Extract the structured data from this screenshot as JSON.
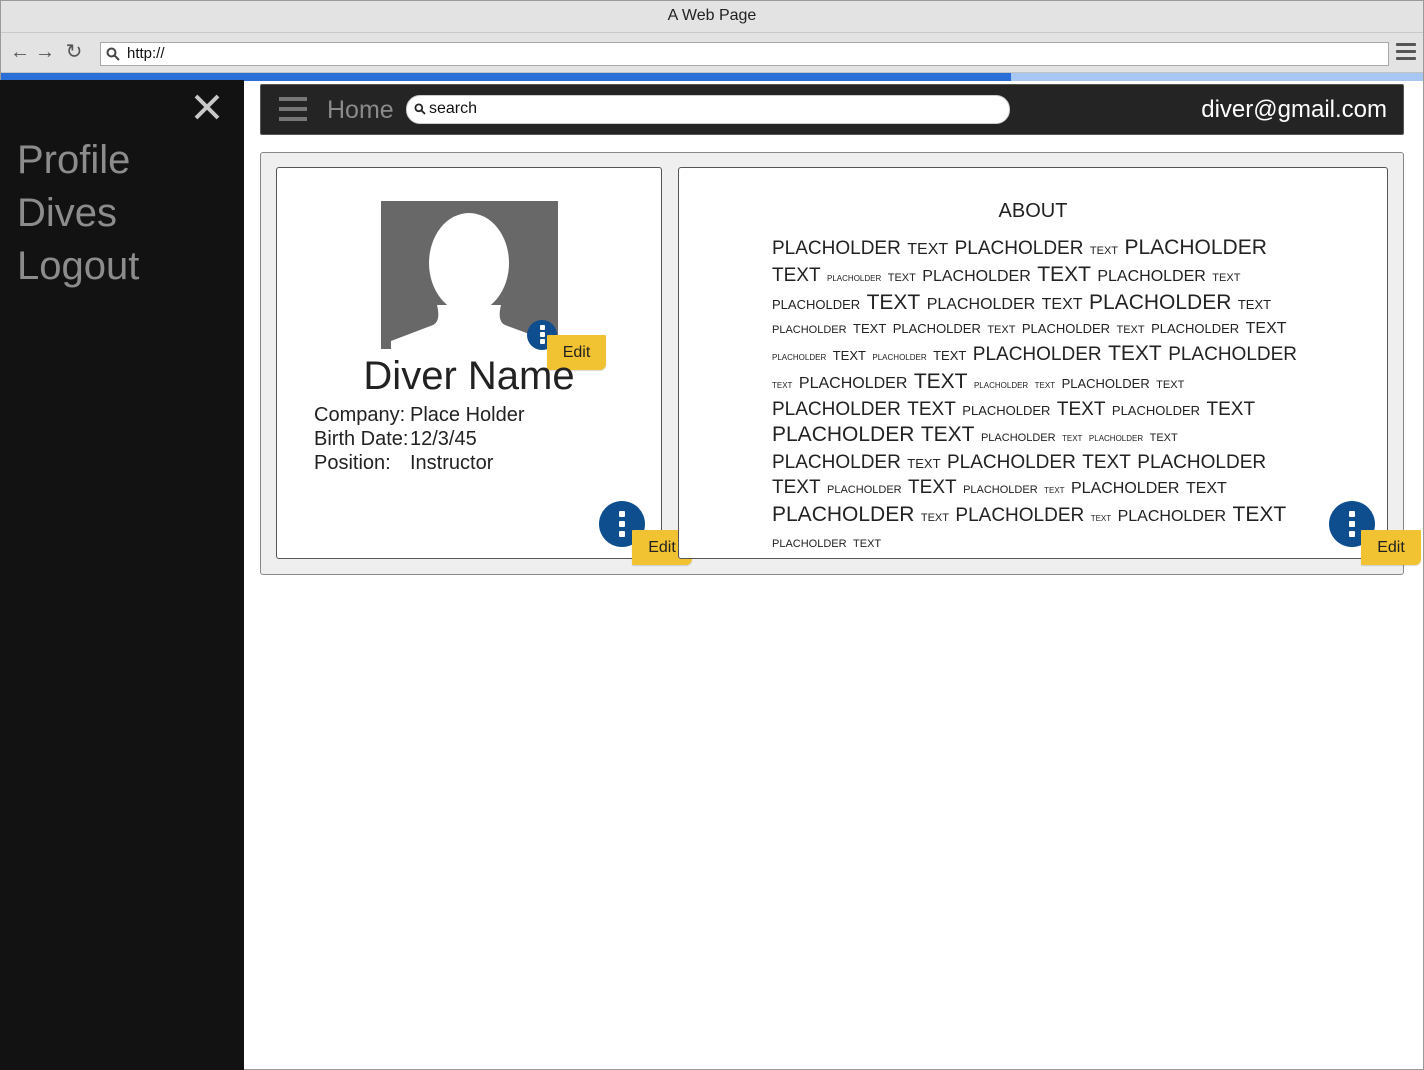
{
  "browser": {
    "title": "A Web Page",
    "url": "http://",
    "progress_fraction": 0.71
  },
  "sidebar": {
    "items": [
      {
        "label": "Profile"
      },
      {
        "label": "Dives"
      },
      {
        "label": "Logout"
      }
    ]
  },
  "header": {
    "home_label": "Home",
    "search_value": "search",
    "user_email": "diver@gmail.com"
  },
  "profile": {
    "name": "Diver Name",
    "fields": [
      {
        "label": "Company:",
        "value": "Place Holder"
      },
      {
        "label": "Birth Date:",
        "value": "12/3/45"
      },
      {
        "label": "Position:",
        "value": "Instructor"
      }
    ],
    "avatar_edit_label": "Edit",
    "card_edit_label": "Edit"
  },
  "about": {
    "title": "ABOUT",
    "edit_label": "Edit",
    "words": [
      [
        "PLACHOLDER",
        5
      ],
      [
        "TEXT",
        4
      ],
      [
        "PLACHOLDER",
        5
      ],
      [
        "TEXT",
        2
      ],
      [
        "PLACHOLDER",
        6
      ],
      [
        "TEXT",
        5
      ],
      [
        "PLACHOLDER",
        1
      ],
      [
        "TEXT",
        2
      ],
      [
        "PLACHOLDER",
        4
      ],
      [
        "TEXT",
        6
      ],
      [
        "PLACHOLDER",
        4
      ],
      [
        "TEXT",
        2
      ],
      [
        "PLACHOLDER",
        3
      ],
      [
        "TEXT",
        6
      ],
      [
        "PLACHOLDER",
        4
      ],
      [
        "TEXT",
        4
      ],
      [
        "PLACHOLDER",
        6
      ],
      [
        "TEXT",
        3
      ],
      [
        "PLACHOLDER",
        2
      ],
      [
        "TEXT",
        3
      ],
      [
        "PLACHOLDER",
        3
      ],
      [
        "TEXT",
        2
      ],
      [
        "PLACHOLDER",
        3
      ],
      [
        "TEXT",
        2
      ],
      [
        "PLACHOLDER",
        3
      ],
      [
        "TEXT",
        4
      ],
      [
        "PLACHOLDER",
        1
      ],
      [
        "TEXT",
        3
      ],
      [
        "PLACHOLDER",
        1
      ],
      [
        "TEXT",
        3
      ],
      [
        "PLACHOLDER",
        5
      ],
      [
        "TEXT",
        6
      ],
      [
        "PLACHOLDER",
        5
      ],
      [
        "TEXT",
        1
      ],
      [
        "PLACHOLDER",
        4
      ],
      [
        "TEXT",
        6
      ],
      [
        "PLACHOLDER",
        1
      ],
      [
        "TEXT",
        1
      ],
      [
        "PLACHOLDER",
        3
      ],
      [
        "TEXT",
        2
      ],
      [
        "PLACHOLDER",
        5
      ],
      [
        "TEXT",
        5
      ],
      [
        "PLACHOLDER",
        3
      ],
      [
        "TEXT",
        5
      ],
      [
        "PLACHOLDER",
        3
      ],
      [
        "TEXT",
        5
      ],
      [
        "PLACHOLDER",
        6
      ],
      [
        "TEXT",
        6
      ],
      [
        "PLACHOLDER",
        2
      ],
      [
        "TEXT",
        1
      ],
      [
        "PLACHOLDER",
        1
      ],
      [
        "TEXT",
        2
      ],
      [
        "PLACHOLDER",
        5
      ],
      [
        "TEXT",
        3
      ],
      [
        "PLACHOLDER",
        5
      ],
      [
        "TEXT",
        5
      ],
      [
        "PLACHOLDER",
        5
      ],
      [
        "TEXT",
        5
      ],
      [
        "PLACHOLDER",
        2
      ],
      [
        "TEXT",
        5
      ],
      [
        "PLACHOLDER",
        2
      ],
      [
        "TEXT",
        1
      ],
      [
        "PLACHOLDER",
        4
      ],
      [
        "TEXT",
        4
      ],
      [
        "PLACHOLDER",
        6
      ],
      [
        "TEXT",
        2
      ],
      [
        "PLACHOLDER",
        5
      ],
      [
        "TEXT",
        1
      ],
      [
        "PLACHOLDER",
        4
      ],
      [
        "TEXT",
        6
      ],
      [
        "PLACHOLDER",
        2
      ],
      [
        "TEXT",
        2
      ]
    ]
  }
}
